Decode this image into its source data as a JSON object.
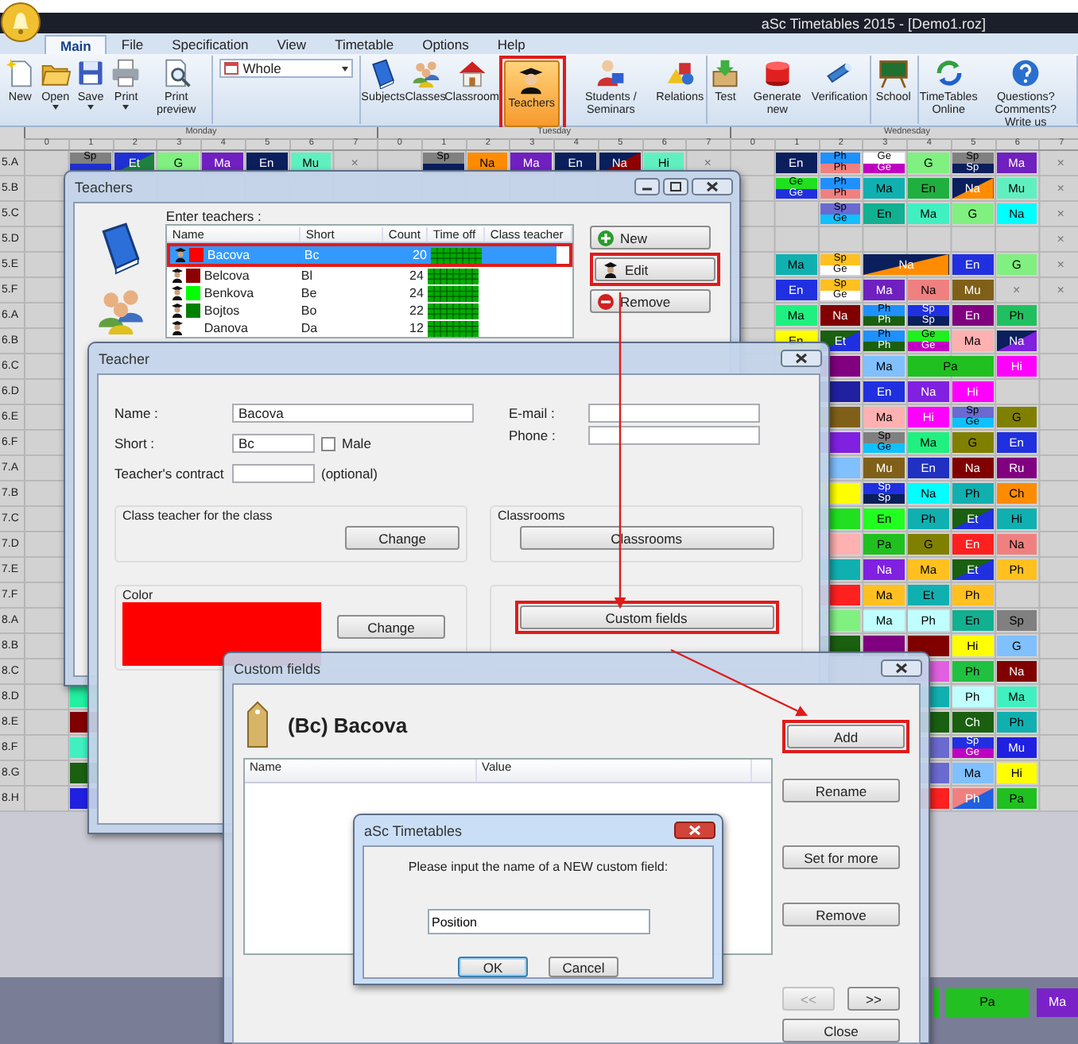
{
  "window": {
    "title": "aSc Timetables 2015  - [Demo1.roz]"
  },
  "ribbon": {
    "tabs": [
      {
        "label": "Main",
        "selected": true
      },
      {
        "label": "File",
        "selected": false
      },
      {
        "label": "Specification",
        "selected": false
      },
      {
        "label": "View",
        "selected": false
      },
      {
        "label": "Timetable",
        "selected": false
      },
      {
        "label": "Options",
        "selected": false
      },
      {
        "label": "Help",
        "selected": false
      }
    ],
    "groups": [
      {
        "kind": "buttons",
        "items": [
          {
            "label": "New",
            "dropdown": false,
            "selected": false
          },
          {
            "label": "Open",
            "dropdown": true,
            "selected": false
          },
          {
            "label": "Save",
            "dropdown": true,
            "selected": false
          },
          {
            "label": "Print",
            "dropdown": true,
            "selected": false
          },
          {
            "label": "Print preview",
            "dropdown": false,
            "selected": false
          }
        ]
      },
      {
        "kind": "combo",
        "value": "Whole"
      },
      {
        "kind": "buttons",
        "items": [
          {
            "label": "Subjects",
            "dropdown": false,
            "selected": false
          },
          {
            "label": "Classes",
            "dropdown": false,
            "selected": false
          },
          {
            "label": "Classroom",
            "dropdown": false,
            "selected": false
          },
          {
            "label": "Teachers",
            "dropdown": false,
            "selected": true,
            "highlighted": true
          },
          {
            "label": "Students / Seminars",
            "dropdown": false,
            "selected": false
          },
          {
            "label": "Relations",
            "dropdown": false,
            "selected": false
          }
        ]
      },
      {
        "kind": "buttons",
        "items": [
          {
            "label": "Test",
            "dropdown": false,
            "selected": false
          },
          {
            "label": "Generate new",
            "dropdown": false,
            "selected": false
          },
          {
            "label": "Verification",
            "dropdown": false,
            "selected": false
          }
        ]
      },
      {
        "kind": "buttons",
        "items": [
          {
            "label": "School",
            "dropdown": false,
            "selected": false
          }
        ]
      },
      {
        "kind": "buttons",
        "items": [
          {
            "label": "TimeTables Online",
            "dropdown": false,
            "selected": false
          },
          {
            "label": "Questions? Comments? Write us",
            "dropdown": false,
            "selected": false
          }
        ]
      }
    ]
  },
  "timetable": {
    "days": [
      {
        "name": "Monday",
        "periods": [
          "0",
          "1",
          "2",
          "3",
          "4",
          "5",
          "6",
          "7"
        ]
      },
      {
        "name": "Tuesday",
        "periods": [
          "0",
          "1",
          "2",
          "3",
          "4",
          "5",
          "6",
          "7"
        ]
      },
      {
        "name": "Wednesday",
        "periods": [
          "0",
          "1",
          "2",
          "3",
          "4",
          "5",
          "6",
          "7"
        ]
      }
    ],
    "rows": [
      {
        "label": "5.A",
        "monday": [
          {
            "kind": "empty"
          },
          {
            "kind": "split",
            "top": {
              "label": "Sp",
              "color": "#808080"
            },
            "bottom": {
              "color": "#2030d0"
            }
          },
          {
            "kind": "diagonal",
            "label": "Et",
            "color": "#2030d0",
            "corner": {
              "color": "#208040"
            }
          },
          {
            "kind": "lesson",
            "label": "G",
            "color": "#80f080"
          },
          {
            "kind": "lesson",
            "label": "Ma",
            "color": "#7020c0"
          },
          {
            "kind": "lesson",
            "label": "En",
            "color": "#0a1f5c"
          },
          {
            "kind": "lesson",
            "label": "Mu",
            "color": "#60f0c0"
          },
          {
            "kind": "mark",
            "label": "×"
          }
        ],
        "tuesday": [
          {
            "kind": "empty"
          },
          {
            "kind": "split",
            "top": {
              "label": "Sp",
              "color": "#808080"
            },
            "bottom": {
              "color": "#0a1f5c"
            }
          },
          {
            "kind": "lesson",
            "label": "Na",
            "color": "#ff8c00"
          },
          {
            "kind": "lesson",
            "label": "Ma",
            "color": "#7020c0"
          },
          {
            "kind": "lesson",
            "label": "En",
            "color": "#0a1f5c"
          },
          {
            "kind": "diagonal",
            "label": "Na",
            "color": "#0a1f5c",
            "corner": {
              "color": "#900000"
            }
          },
          {
            "kind": "lesson",
            "label": "Hi",
            "color": "#60f0c0"
          },
          {
            "kind": "mark",
            "label": "×"
          }
        ],
        "wednesday": [
          {
            "kind": "empty"
          },
          {
            "kind": "lesson",
            "label": "En",
            "color": "#0a1f5c"
          },
          {
            "kind": "split",
            "top": {
              "label": "Ph",
              "color": "#1e90ff"
            },
            "bottom": {
              "label": "Ph",
              "color": "#f08080"
            }
          },
          {
            "kind": "split",
            "top": {
              "label": "Ge",
              "color": "#ffffff"
            },
            "bottom": {
              "label": "Ge",
              "color": "#c000c0"
            }
          },
          {
            "kind": "lesson",
            "label": "G",
            "color": "#80f080"
          },
          {
            "kind": "split",
            "top": {
              "label": "Sp",
              "color": "#808080"
            },
            "bottom": {
              "label": "Sp",
              "color": "#0a1f5c"
            }
          },
          {
            "kind": "lesson",
            "label": "Ma",
            "color": "#7020c0"
          },
          {
            "kind": "mark",
            "label": "×"
          }
        ]
      },
      {
        "label": "5.B",
        "wednesday": [
          {
            "kind": "empty"
          },
          {
            "kind": "split",
            "top": {
              "label": "Ge",
              "color": "#20e020"
            },
            "bottom": {
              "label": "Ge",
              "color": "#2030e0"
            }
          },
          {
            "kind": "split",
            "top": {
              "label": "Ph",
              "color": "#1e90ff"
            },
            "bottom": {
              "label": "Ph",
              "color": "#f08080"
            }
          },
          {
            "kind": "lesson",
            "label": "Ma",
            "color": "#10b0b0"
          },
          {
            "kind": "lesson",
            "label": "En",
            "color": "#20b040"
          },
          {
            "kind": "diagonal",
            "label": "Na",
            "color": "#0a1f5c",
            "corner": {
              "color": "#ff8c00"
            }
          },
          {
            "kind": "lesson",
            "label": "Mu",
            "color": "#60f0c0"
          },
          {
            "kind": "mark",
            "label": "×"
          }
        ]
      },
      {
        "label": "5.C",
        "wednesday": [
          {
            "kind": "empty"
          },
          {
            "kind": "empty"
          },
          {
            "kind": "split",
            "top": {
              "label": "Sp",
              "color": "#6a6ad0"
            },
            "bottom": {
              "label": "Ge",
              "color": "#10c0ff"
            }
          },
          {
            "kind": "lesson",
            "label": "En",
            "color": "#10b090"
          },
          {
            "kind": "lesson",
            "label": "Ma",
            "color": "#40f0c0"
          },
          {
            "kind": "lesson",
            "label": "G",
            "color": "#80f080"
          },
          {
            "kind": "lesson",
            "label": "Na",
            "color": "#00ffff"
          },
          {
            "kind": "mark",
            "label": "×"
          }
        ]
      },
      {
        "label": "5.D",
        "wednesday": [
          {
            "kind": "empty"
          },
          {
            "kind": "empty"
          },
          {
            "kind": "empty"
          },
          {
            "kind": "empty"
          },
          {
            "kind": "empty"
          },
          {
            "kind": "empty"
          },
          {
            "kind": "empty"
          },
          {
            "kind": "mark",
            "label": "×"
          }
        ]
      },
      {
        "label": "5.E",
        "wednesday": [
          {
            "kind": "empty"
          },
          {
            "kind": "lesson",
            "label": "Ma",
            "color": "#10b0b0"
          },
          {
            "kind": "split",
            "top": {
              "label": "Sp",
              "color": "#ffc020"
            },
            "bottom": {
              "label": "Ge",
              "color": "#ffffff"
            }
          },
          {
            "kind": "diagonal",
            "label": "Na",
            "color": "#0a1f5c",
            "corner": {
              "color": "#ff8c00"
            }
          },
          {
            "kind": "span"
          },
          {
            "kind": "lesson",
            "label": "En",
            "color": "#2030e0"
          },
          {
            "kind": "lesson",
            "label": "G",
            "color": "#80f080"
          },
          {
            "kind": "mark",
            "label": "×"
          }
        ]
      },
      {
        "label": "5.F",
        "wednesday": [
          {
            "kind": "empty"
          },
          {
            "kind": "lesson",
            "label": "En",
            "color": "#2030e0"
          },
          {
            "kind": "split",
            "top": {
              "label": "Sp",
              "color": "#ffc020"
            },
            "bottom": {
              "label": "Ge",
              "color": "#ffffff"
            }
          },
          {
            "kind": "lesson",
            "label": "Ma",
            "color": "#7020c0"
          },
          {
            "kind": "lesson",
            "label": "Na",
            "color": "#f08080"
          },
          {
            "kind": "lesson",
            "label": "Mu",
            "color": "#806018"
          },
          {
            "kind": "mark",
            "label": "×"
          },
          {
            "kind": "mark",
            "label": "×"
          }
        ]
      },
      {
        "label": "6.A",
        "wednesday": [
          {
            "kind": "empty"
          },
          {
            "kind": "lesson",
            "label": "Ma",
            "color": "#20f080"
          },
          {
            "kind": "lesson",
            "label": "Na",
            "color": "#800000"
          },
          {
            "kind": "split",
            "top": {
              "label": "Ph",
              "color": "#1e90ff"
            },
            "bottom": {
              "label": "Ph",
              "color": "#1a6010"
            }
          },
          {
            "kind": "split",
            "top": {
              "label": "Sp",
              "color": "#2030e0"
            },
            "bottom": {
              "label": "Sp",
              "color": "#0a1f5c"
            }
          },
          {
            "kind": "lesson",
            "label": "En",
            "color": "#800080"
          },
          {
            "kind": "lesson",
            "label": "Ph",
            "color": "#20c060"
          }
        ]
      },
      {
        "label": "6.B",
        "wednesday": [
          {
            "kind": "empty"
          },
          {
            "kind": "lesson",
            "label": "En",
            "color": "#ffff00"
          },
          {
            "kind": "diagonal",
            "label": "Et",
            "color": "#1a6010",
            "corner": {
              "color": "#2030e0"
            }
          },
          {
            "kind": "split",
            "top": {
              "label": "Ph",
              "color": "#1e90ff"
            },
            "bottom": {
              "label": "Ph",
              "color": "#1a6010"
            }
          },
          {
            "kind": "split",
            "top": {
              "label": "Ge",
              "color": "#20f020"
            },
            "bottom": {
              "label": "Ge",
              "color": "#c000c0"
            }
          },
          {
            "kind": "lesson",
            "label": "Ma",
            "color": "#ffb0b0"
          },
          {
            "kind": "diagonal",
            "label": "Na",
            "color": "#0a1f5c",
            "corner": {
              "color": "#8020e0"
            }
          }
        ]
      },
      {
        "label": "6.C",
        "wednesday": [
          {
            "kind": "empty"
          },
          {
            "kind": "empty"
          },
          {
            "kind": "lesson",
            "color": "#800080"
          },
          {
            "kind": "lesson",
            "label": "Ma",
            "color": "#80c0ff"
          },
          {
            "kind": "lesson",
            "label": "Pa",
            "color": "#20c020"
          },
          {
            "kind": "span"
          },
          {
            "kind": "lesson",
            "label": "Hi",
            "color": "#ff00ff"
          }
        ]
      },
      {
        "label": "6.D",
        "wednesday": [
          {
            "kind": "empty"
          },
          {
            "kind": "empty"
          },
          {
            "kind": "lesson",
            "color": "#2020a0"
          },
          {
            "kind": "lesson",
            "label": "En",
            "color": "#2030e0"
          },
          {
            "kind": "lesson",
            "label": "Na",
            "color": "#8020e0"
          },
          {
            "kind": "lesson",
            "label": "Hi",
            "color": "#ff00ff"
          }
        ]
      },
      {
        "label": "6.E",
        "wednesday": [
          {
            "kind": "empty"
          },
          {
            "kind": "empty"
          },
          {
            "kind": "lesson",
            "color": "#806018"
          },
          {
            "kind": "lesson",
            "label": "Ma",
            "color": "#ffb0b0"
          },
          {
            "kind": "lesson",
            "label": "Hi",
            "color": "#ff00ff"
          },
          {
            "kind": "split",
            "top": {
              "label": "Sp",
              "color": "#6a6ad0"
            },
            "bottom": {
              "label": "Ge",
              "color": "#10c0ff"
            }
          },
          {
            "kind": "lesson",
            "label": "G",
            "color": "#808000"
          }
        ]
      },
      {
        "label": "6.F",
        "wednesday": [
          {
            "kind": "empty"
          },
          {
            "kind": "empty"
          },
          {
            "kind": "lesson",
            "color": "#8020e0"
          },
          {
            "kind": "split",
            "top": {
              "label": "Sp",
              "color": "#808080"
            },
            "bottom": {
              "label": "Ge",
              "color": "#10c0ff"
            }
          },
          {
            "kind": "lesson",
            "label": "Ma",
            "color": "#20f080"
          },
          {
            "kind": "lesson",
            "label": "G",
            "color": "#808000"
          },
          {
            "kind": "lesson",
            "label": "En",
            "color": "#2030e0"
          }
        ]
      },
      {
        "label": "7.A",
        "wednesday": [
          {
            "kind": "empty"
          },
          {
            "kind": "empty"
          },
          {
            "kind": "lesson",
            "color": "#80c0ff"
          },
          {
            "kind": "lesson",
            "label": "Mu",
            "color": "#806018"
          },
          {
            "kind": "lesson",
            "label": "En",
            "color": "#2030c0"
          },
          {
            "kind": "lesson",
            "label": "Na",
            "color": "#800000"
          },
          {
            "kind": "lesson",
            "label": "Ru",
            "color": "#800080"
          }
        ]
      },
      {
        "label": "7.B",
        "wednesday": [
          {
            "kind": "empty"
          },
          {
            "kind": "empty"
          },
          {
            "kind": "lesson",
            "color": "#ffff00"
          },
          {
            "kind": "split",
            "top": {
              "label": "Sp",
              "color": "#2030e0"
            },
            "bottom": {
              "label": "Sp",
              "color": "#0a1f5c"
            }
          },
          {
            "kind": "lesson",
            "label": "Na",
            "color": "#00ffff"
          },
          {
            "kind": "lesson",
            "label": "Ph",
            "color": "#10b0b0"
          },
          {
            "kind": "lesson",
            "label": "Ch",
            "color": "#ff8c00"
          }
        ]
      },
      {
        "label": "7.C",
        "wednesday": [
          {
            "kind": "empty"
          },
          {
            "kind": "empty"
          },
          {
            "kind": "lesson",
            "color": "#20e020"
          },
          {
            "kind": "lesson",
            "label": "En",
            "color": "#20ff20"
          },
          {
            "kind": "lesson",
            "label": "Ph",
            "color": "#10b0b0"
          },
          {
            "kind": "diagonal",
            "label": "Et",
            "color": "#1a6010",
            "corner": {
              "color": "#2030e0"
            }
          },
          {
            "kind": "lesson",
            "label": "Hi",
            "color": "#10b0b0"
          }
        ]
      },
      {
        "label": "7.D",
        "wednesday": [
          {
            "kind": "empty"
          },
          {
            "kind": "empty"
          },
          {
            "kind": "lesson",
            "color": "#ffb0b0"
          },
          {
            "kind": "lesson",
            "label": "Pa",
            "color": "#20c020"
          },
          {
            "kind": "lesson",
            "label": "G",
            "color": "#808000"
          },
          {
            "kind": "lesson",
            "label": "En",
            "color": "#ff2020"
          },
          {
            "kind": "lesson",
            "label": "Na",
            "color": "#f08080"
          }
        ]
      },
      {
        "label": "7.E",
        "wednesday": [
          {
            "kind": "empty"
          },
          {
            "kind": "empty"
          },
          {
            "kind": "lesson",
            "color": "#10b0b0"
          },
          {
            "kind": "lesson",
            "label": "Na",
            "color": "#8020e0"
          },
          {
            "kind": "lesson",
            "label": "Ma",
            "color": "#ffc020"
          },
          {
            "kind": "diagonal",
            "label": "Et",
            "color": "#1a6010",
            "corner": {
              "color": "#2030e0"
            }
          },
          {
            "kind": "lesson",
            "label": "Ph",
            "color": "#ffc020"
          }
        ]
      },
      {
        "label": "7.F",
        "wednesday": [
          {
            "kind": "empty"
          },
          {
            "kind": "empty"
          },
          {
            "kind": "lesson",
            "color": "#ff2020"
          },
          {
            "kind": "lesson",
            "label": "Ma",
            "color": "#ffc020"
          },
          {
            "kind": "lesson",
            "label": "Et",
            "color": "#10b0b0"
          },
          {
            "kind": "lesson",
            "label": "Ph",
            "color": "#ffc020"
          }
        ]
      },
      {
        "label": "8.A",
        "wednesday": [
          {
            "kind": "empty"
          },
          {
            "kind": "empty"
          },
          {
            "kind": "lesson",
            "color": "#80f080"
          },
          {
            "kind": "lesson",
            "label": "Ma",
            "color": "#c0ffff"
          },
          {
            "kind": "lesson",
            "label": "Ph",
            "color": "#c0ffff"
          },
          {
            "kind": "lesson",
            "label": "En",
            "color": "#10b090"
          },
          {
            "kind": "lesson",
            "label": "Sp",
            "color": "#808080"
          }
        ]
      },
      {
        "label": "8.B",
        "wednesday": [
          {
            "kind": "empty"
          },
          {
            "kind": "empty"
          },
          {
            "kind": "lesson",
            "color": "#1a6010"
          },
          {
            "kind": "lesson",
            "color": "#800080"
          },
          {
            "kind": "lesson",
            "color": "#800000"
          },
          {
            "kind": "lesson",
            "label": "Hi",
            "color": "#ffff00"
          },
          {
            "kind": "lesson",
            "label": "G",
            "color": "#80c0ff"
          }
        ]
      },
      {
        "label": "8.C",
        "wednesday": [
          {
            "kind": "empty"
          },
          {
            "kind": "empty"
          },
          {
            "kind": "empty"
          },
          {
            "kind": "empty"
          },
          {
            "kind": "lesson",
            "color": "#e060e0"
          },
          {
            "kind": "lesson",
            "label": "Ph",
            "color": "#20c040"
          },
          {
            "kind": "lesson",
            "label": "Na",
            "color": "#800000"
          }
        ]
      },
      {
        "label": "8.D",
        "monday": [
          {
            "kind": "empty"
          },
          {
            "kind": "lesson",
            "color": "#20f0a0"
          }
        ],
        "wednesday": [
          {
            "kind": "empty"
          },
          {
            "kind": "empty"
          },
          {
            "kind": "empty"
          },
          {
            "kind": "empty"
          },
          {
            "kind": "lesson",
            "color": "#10b0b0"
          },
          {
            "kind": "lesson",
            "label": "Ph",
            "color": "#c0ffff"
          },
          {
            "kind": "lesson",
            "label": "Ma",
            "color": "#40f0c0"
          }
        ]
      },
      {
        "label": "8.E",
        "monday": [
          {
            "kind": "empty"
          },
          {
            "kind": "lesson",
            "color": "#800000"
          }
        ],
        "wednesday": [
          {
            "kind": "empty"
          },
          {
            "kind": "empty"
          },
          {
            "kind": "empty"
          },
          {
            "kind": "empty"
          },
          {
            "kind": "lesson",
            "color": "#1a6010"
          },
          {
            "kind": "lesson",
            "label": "Ch",
            "color": "#1a6010"
          },
          {
            "kind": "lesson",
            "label": "Ph",
            "color": "#10b0b0"
          }
        ]
      },
      {
        "label": "8.F",
        "monday": [
          {
            "kind": "empty"
          },
          {
            "kind": "lesson",
            "color": "#40f0c0"
          }
        ],
        "wednesday": [
          {
            "kind": "empty"
          },
          {
            "kind": "empty"
          },
          {
            "kind": "empty"
          },
          {
            "kind": "empty"
          },
          {
            "kind": "lesson",
            "color": "#6a6ad0"
          },
          {
            "kind": "split",
            "top": {
              "label": "Sp",
              "color": "#2030e0"
            },
            "bottom": {
              "label": "Ge",
              "color": "#c000c0"
            }
          },
          {
            "kind": "lesson",
            "label": "Mu",
            "color": "#2020e0"
          }
        ]
      },
      {
        "label": "8.G",
        "monday": [
          {
            "kind": "empty"
          },
          {
            "kind": "lesson",
            "color": "#1a6010"
          }
        ],
        "wednesday": [
          {
            "kind": "empty"
          },
          {
            "kind": "empty"
          },
          {
            "kind": "empty"
          },
          {
            "kind": "empty"
          },
          {
            "kind": "lesson",
            "color": "#6a6ad0"
          },
          {
            "kind": "lesson",
            "label": "Ma",
            "color": "#80c0ff"
          },
          {
            "kind": "lesson",
            "label": "Hi",
            "color": "#ffff00"
          }
        ]
      },
      {
        "label": "8.H",
        "monday": [
          {
            "kind": "empty"
          },
          {
            "kind": "lesson",
            "color": "#2020e0"
          }
        ],
        "wednesday": [
          {
            "kind": "empty"
          },
          {
            "kind": "empty"
          },
          {
            "kind": "empty"
          },
          {
            "kind": "empty"
          },
          {
            "kind": "lesson",
            "color": "#ff2020"
          },
          {
            "kind": "diagonal",
            "label": "Ph",
            "color": "#f08080",
            "corner": {
              "color": "#2060e0"
            }
          },
          {
            "kind": "lesson",
            "label": "Pa",
            "color": "#20c020"
          }
        ]
      }
    ]
  },
  "tray": [
    {
      "color": "#20c020"
    },
    {
      "label": "Pa",
      "color": "#22c022"
    },
    {
      "label": "Ma",
      "color": "#7a22c8"
    }
  ],
  "teachers_window": {
    "title": "Teachers",
    "prompt": "Enter teachers :",
    "columns": [
      "Name",
      "Short",
      "Count",
      "Time off",
      "Class teacher"
    ],
    "rows": [
      {
        "name": "Bacova",
        "short": "Bc",
        "count": "20",
        "color": "#ff0000",
        "selected": true,
        "highlighted": true
      },
      {
        "name": "Belcova",
        "short": "Bl",
        "count": "24",
        "color": "#8b0000",
        "selected": false
      },
      {
        "name": "Benkova",
        "short": "Be",
        "count": "24",
        "color": "#00ff00",
        "selected": false
      },
      {
        "name": "Bojtos",
        "short": "Bo",
        "count": "22",
        "color": "#008000",
        "selected": false
      },
      {
        "name": "Danova",
        "short": "Da",
        "count": "12",
        "selected": false
      }
    ],
    "buttons": [
      {
        "label": "New",
        "kind": "add"
      },
      {
        "label": "Edit",
        "kind": "edit",
        "highlighted": true
      },
      {
        "label": "Remove",
        "kind": "remove"
      }
    ]
  },
  "teacher_dialog": {
    "title": "Teacher",
    "name": {
      "label": "Name :",
      "value": "Bacova"
    },
    "short": {
      "label": "Short :",
      "value": "Bc"
    },
    "male": {
      "label": "Male",
      "checked": false
    },
    "contract": {
      "label": "Teacher's contract",
      "note": "(optional)"
    },
    "email": {
      "label": "E-mail :"
    },
    "phone": {
      "label": "Phone :"
    },
    "class_teacher": {
      "title": "Class teacher for the class",
      "button": "Change"
    },
    "classrooms": {
      "title": "Classrooms",
      "button": "Classrooms"
    },
    "color_box": {
      "title": "Color",
      "color": "#ff0000",
      "button": "Change"
    },
    "custom": {
      "button": "Custom fields",
      "highlighted": true
    }
  },
  "custom_fields_window": {
    "title": "Custom fields",
    "heading": "(Bc) Bacova",
    "columns": [
      "Name",
      "Value"
    ],
    "side_buttons": [
      {
        "label": "Add",
        "highlighted": true
      },
      {
        "label": "Rename"
      },
      {
        "label": "Set for more"
      },
      {
        "label": "Remove"
      }
    ],
    "nav_buttons": [
      {
        "label": "<<",
        "disabled": true
      },
      {
        "label": ">>",
        "disabled": false
      }
    ],
    "close_button": "Close"
  },
  "message_dialog": {
    "title": "aSc Timetables",
    "text": "Please input the name of a NEW custom field:",
    "value": "Position",
    "buttons": [
      {
        "label": "OK",
        "default": true
      },
      {
        "label": "Cancel",
        "default": false
      }
    ]
  }
}
